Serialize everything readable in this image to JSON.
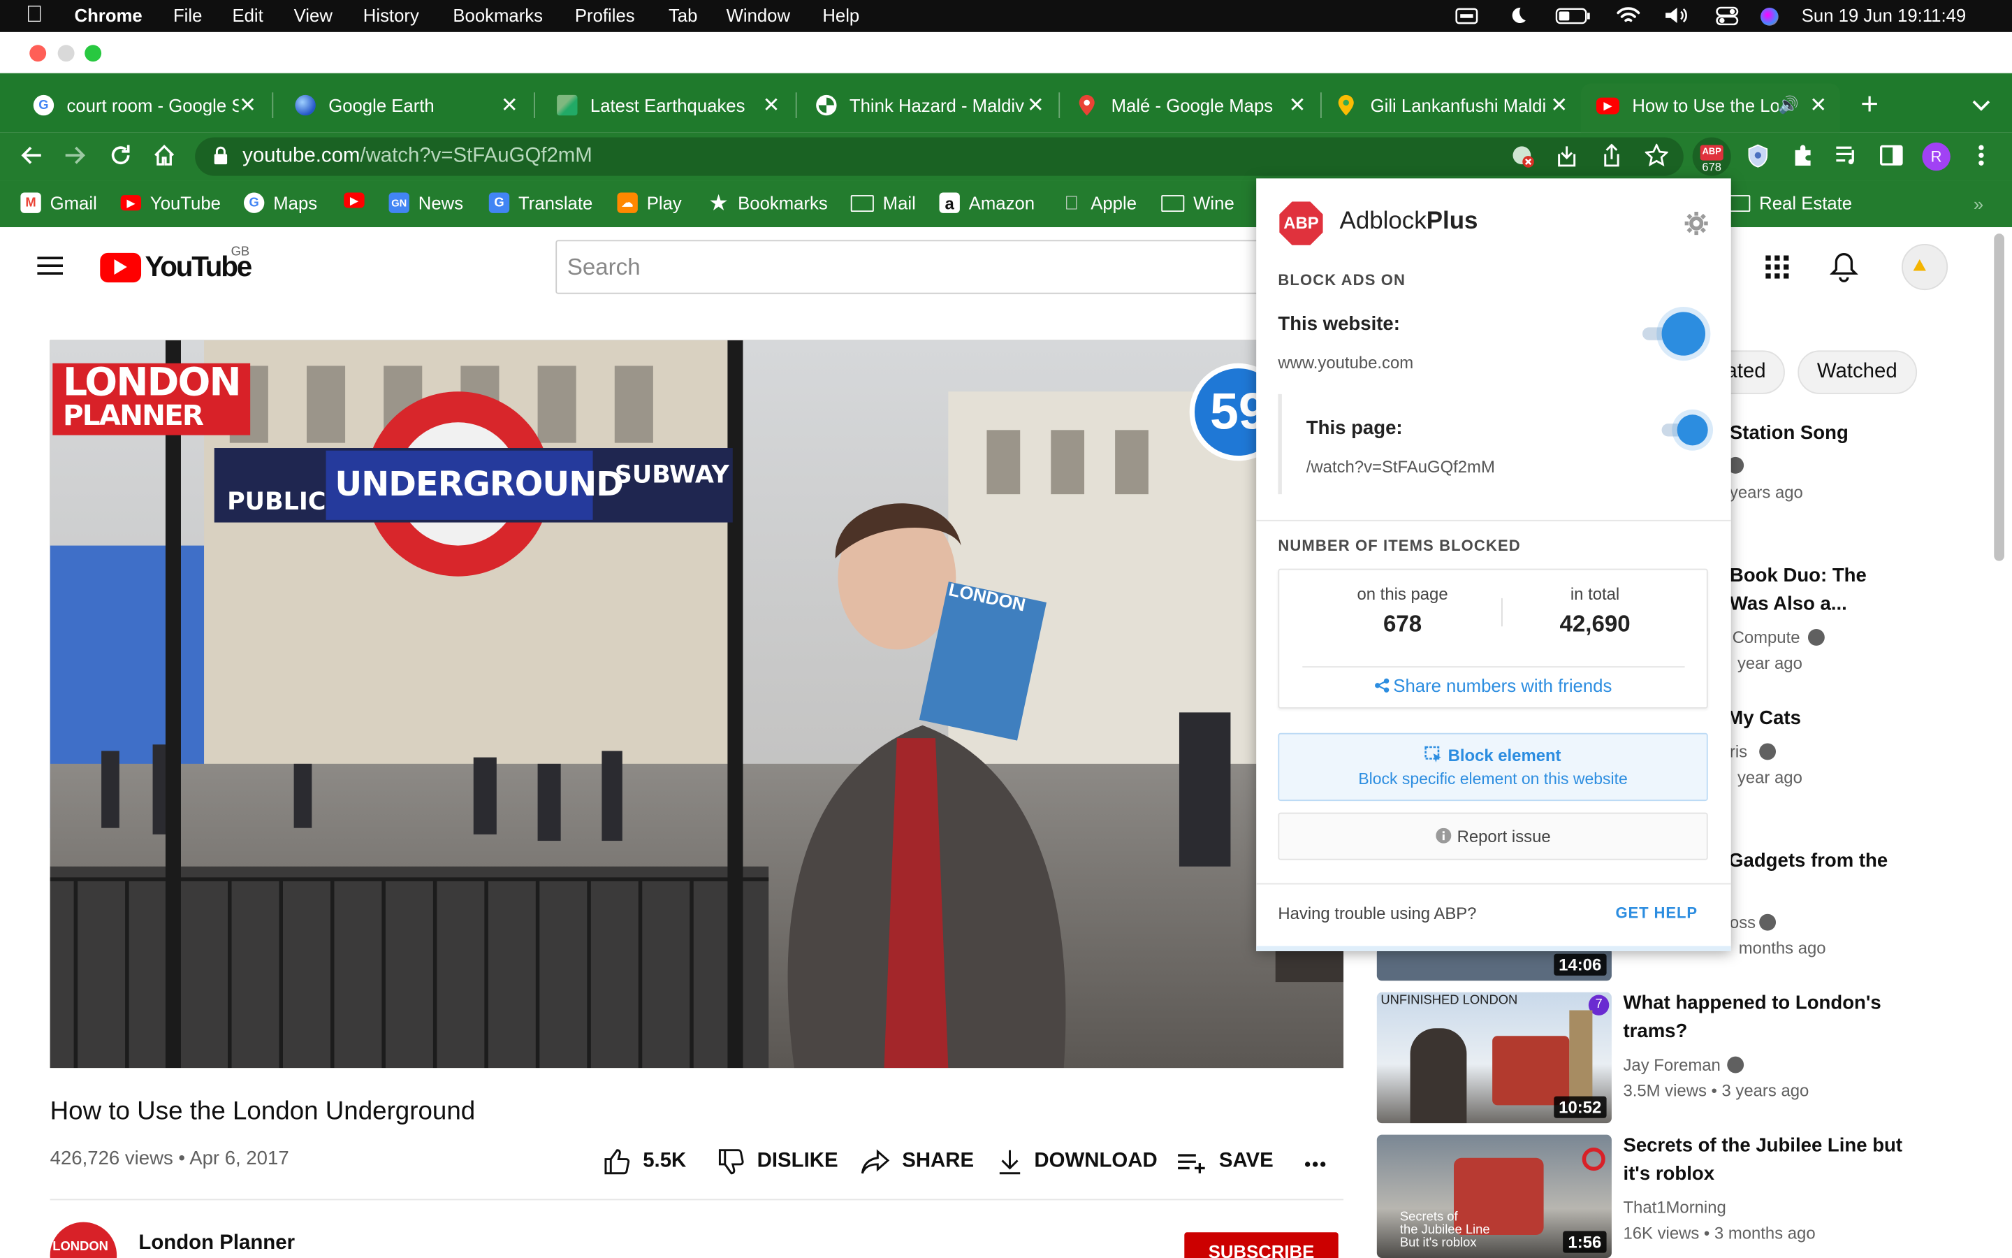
{
  "colors": {
    "accent": "#2c8de0",
    "tab_green": "#1f7a2c",
    "yt_red": "#ff0000",
    "abp_red": "#e0323d"
  },
  "menubar": {
    "app": "Chrome",
    "items": [
      "File",
      "Edit",
      "View",
      "History",
      "Bookmarks",
      "Profiles",
      "Tab",
      "Window",
      "Help"
    ],
    "datetime": "Sun 19 Jun  19:11:49"
  },
  "tabs": [
    {
      "title": "court room - Google S",
      "icon": "google-icon"
    },
    {
      "title": "Google Earth",
      "icon": "earth-icon"
    },
    {
      "title": "Latest Earthquakes",
      "icon": "earthquake-icon"
    },
    {
      "title": "Think Hazard - Maldiv",
      "icon": "hazard-icon"
    },
    {
      "title": "Malé - Google Maps",
      "icon": "maps-icon"
    },
    {
      "title": "Gili Lankanfushi Maldi",
      "icon": "maps-icon"
    },
    {
      "title": "How to Use the Lo",
      "icon": "youtube-icon",
      "active": true
    }
  ],
  "address": {
    "host": "youtube.com",
    "path": "/watch?v=StFAuGQf2mM"
  },
  "extension_badge": {
    "label": "ABP",
    "count": "678"
  },
  "profile_initial": "R",
  "bookmarks": [
    "Gmail",
    "YouTube",
    "Maps",
    "",
    "News",
    "Translate",
    "Play",
    "Bookmarks",
    "Mail",
    "Amazon",
    "Apple",
    "Wine",
    "Real Estate"
  ],
  "youtube": {
    "logo_text": "YouTube",
    "region": "GB",
    "search_placeholder": "Search",
    "video": {
      "title": "How to Use the London Underground",
      "views_date": "426,726 views • Apr 6, 2017",
      "likes": "5.5K",
      "dislike": "DISLIKE",
      "share": "SHARE",
      "download": "DOWNLOAD",
      "save": "SAVE",
      "channel": "London Planner",
      "channel_badge": "LONDON",
      "subscribe": "SUBSCRIBE",
      "overlay_brand_1": "LONDON",
      "overlay_brand_2": "PLANNER",
      "sign_left": "PUBLIC",
      "sign_mid": "UNDERGROUND",
      "sign_right": "SUBWAY",
      "timer": "59",
      "book": "LONDON"
    },
    "chips": [
      "ated",
      "Watched"
    ],
    "recs": [
      {
        "title": "Station Song",
        "meta1": "",
        "meta2": "years ago"
      },
      {
        "title": "Book Duo: The\nWas Also a...",
        "meta1": "Compute",
        "meta2": "year ago"
      },
      {
        "title": "My Cats",
        "meta1": "ris",
        "meta2": "year ago"
      },
      {
        "title": "Gadgets from the",
        "meta1": "oss",
        "meta2": "months ago",
        "duration": "14:06"
      },
      {
        "title": "What happened to London's\ntrams?",
        "meta1": "Jay Foreman",
        "meta2": "3.5M views • 3 years ago",
        "duration": "10:52",
        "thumb_text": "UNFINISHED LONDON",
        "badge": "7"
      },
      {
        "title": "Secrets of the Jubilee Line but\nit's roblox",
        "meta1": "That1Morning",
        "meta2": "16K views • 3 months ago",
        "duration": "1:56",
        "thumb_text": "Secrets of\nthe Jubilee Line\nBut it's roblox"
      }
    ]
  },
  "abp": {
    "brand_plain": "Adblock",
    "brand_bold": "Plus",
    "logo": "ABP",
    "block_ads_on": "BLOCK ADS ON",
    "website_label": "This website:",
    "website_value": "www.youtube.com",
    "website_enabled": true,
    "page_label": "This page:",
    "page_value": "/watch?v=StFAuGQf2mM",
    "page_enabled": true,
    "items_blocked": "NUMBER OF ITEMS BLOCKED",
    "on_this_page_label": "on this page",
    "on_this_page": "678",
    "in_total_label": "in total",
    "in_total": "42,690",
    "share": "Share numbers with friends",
    "block_element": "Block element",
    "block_element_sub": "Block specific element on this website",
    "report": "Report issue",
    "trouble": "Having trouble using ABP?",
    "get_help": "GET HELP"
  }
}
